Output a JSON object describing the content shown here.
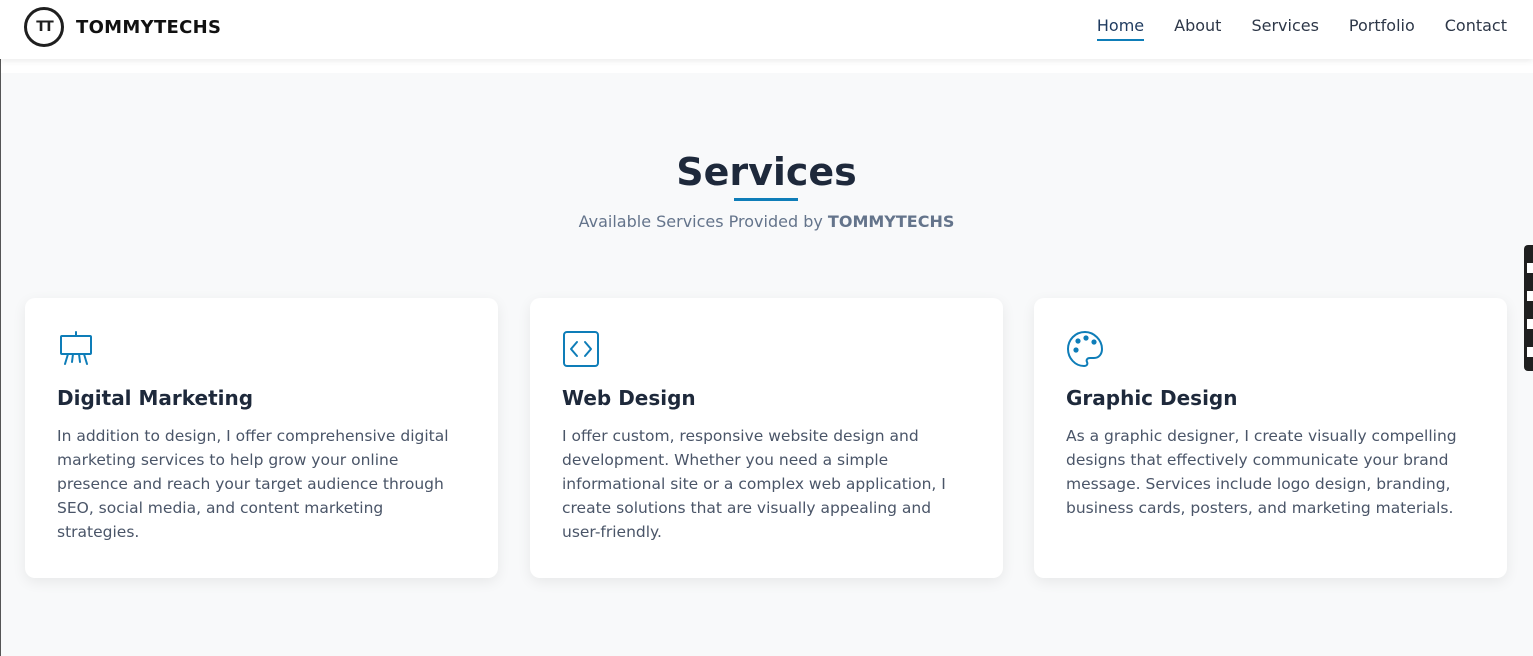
{
  "header": {
    "logo_mark": "TT",
    "brand": "TOMMYTECHS",
    "nav": [
      {
        "label": "Home",
        "active": true
      },
      {
        "label": "About",
        "active": false
      },
      {
        "label": "Services",
        "active": false
      },
      {
        "label": "Portfolio",
        "active": false
      },
      {
        "label": "Contact",
        "active": false
      }
    ]
  },
  "section": {
    "title": "Services",
    "subtitle_prefix": "Available Services Provided by ",
    "subtitle_brand": "TOMMYTECHS"
  },
  "services": [
    {
      "icon": "presentation-easel-icon",
      "title": "Digital Marketing",
      "text": "In addition to design, I offer comprehensive digital marketing services to help grow your online presence and reach your target audience through SEO, social media, and content marketing strategies."
    },
    {
      "icon": "code-brackets-icon",
      "title": "Web Design",
      "text": "I offer custom, responsive website design and development. Whether you need a simple informational site or a complex web application, I create solutions that are visually appealing and user-friendly."
    },
    {
      "icon": "palette-icon",
      "title": "Graphic Design",
      "text": "As a graphic designer, I create visually compelling designs that effectively communicate your brand message. Services include logo design, branding, business cards, posters, and marketing materials."
    }
  ],
  "colors": {
    "accent": "#0e7db8",
    "heading": "#1e293b",
    "body_text": "#4a5568",
    "page_bg": "#f8f9fa"
  }
}
